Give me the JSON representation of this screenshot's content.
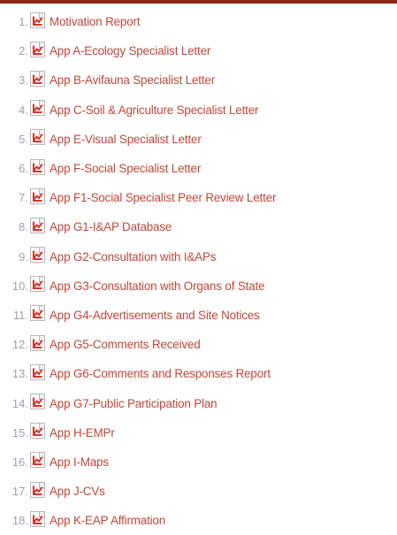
{
  "documents": [
    {
      "number": "1.",
      "label": "Motivation Report",
      "icon": "pdf-icon"
    },
    {
      "number": "2.",
      "label": "App A-Ecology Specialist Letter",
      "icon": "pdf-icon"
    },
    {
      "number": "3.",
      "label": "App B-Avifauna Specialist Letter",
      "icon": "pdf-icon"
    },
    {
      "number": "4.",
      "label": "App C-Soil & Agriculture Specialist Letter",
      "icon": "pdf-icon"
    },
    {
      "number": "5.",
      "label": "App E-Visual Specialist Letter",
      "icon": "pdf-icon"
    },
    {
      "number": "6.",
      "label": "App F-Social Specialist Letter",
      "icon": "pdf-icon"
    },
    {
      "number": "7.",
      "label": "App F1-Social Specialist Peer Review Letter",
      "icon": "pdf-icon"
    },
    {
      "number": "8.",
      "label": "App G1-I&AP Database",
      "icon": "pdf-icon"
    },
    {
      "number": "9.",
      "label": "App G2-Consultation with I&APs",
      "icon": "pdf-icon"
    },
    {
      "number": "10.",
      "label": "App G3-Consultation with Organs of State",
      "icon": "pdf-icon"
    },
    {
      "number": "11.",
      "label": "App G4-Advertisements and Site Notices",
      "icon": "pdf-icon"
    },
    {
      "number": "12.",
      "label": "App G5-Comments Received",
      "icon": "pdf-icon"
    },
    {
      "number": "13.",
      "label": "App G6-Comments and Responses Report",
      "icon": "pdf-icon"
    },
    {
      "number": "14.",
      "label": "App G7-Public Participation Plan",
      "icon": "pdf-icon"
    },
    {
      "number": "15.",
      "label": "App H-EMPr",
      "icon": "pdf-icon"
    },
    {
      "number": "16.",
      "label": "App I-Maps",
      "icon": "pdf-icon"
    },
    {
      "number": "17.",
      "label": "App J-CVs",
      "icon": "pdf-icon"
    },
    {
      "number": "18.",
      "label": "App K-EAP Affirmation",
      "icon": "pdf-icon"
    }
  ],
  "colors": {
    "link": "#c0473a",
    "number": "#9aa3ad",
    "top_bar": "#8b2a17",
    "icon_accent": "#d8352a"
  }
}
